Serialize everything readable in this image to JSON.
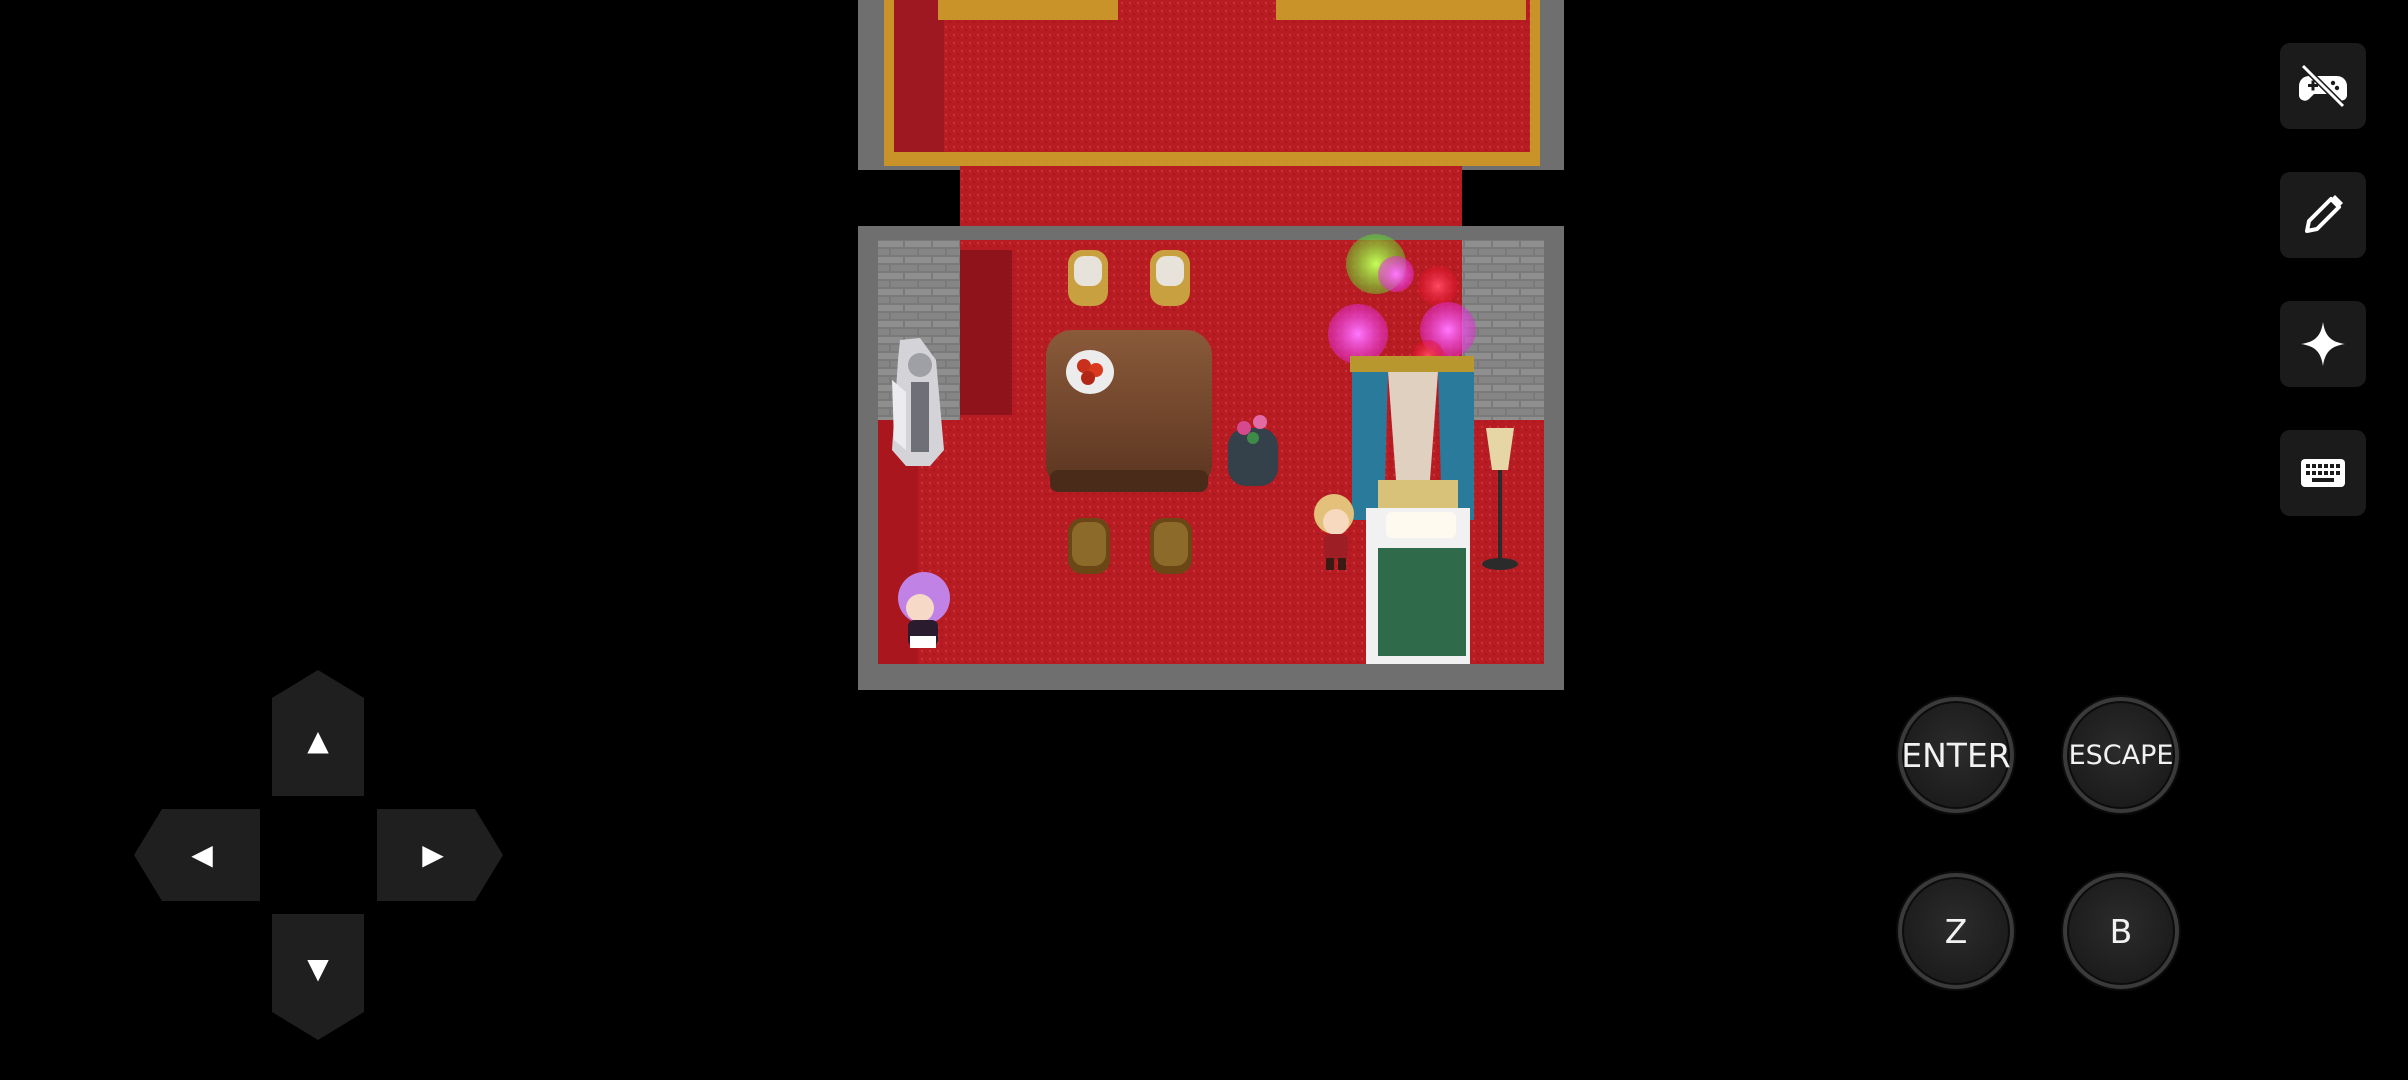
{
  "toolbar": {
    "buttons": [
      {
        "icon": "gamepad-off-icon"
      },
      {
        "icon": "pencil-icon"
      },
      {
        "icon": "sparkle-icon"
      },
      {
        "icon": "keyboard-icon"
      }
    ]
  },
  "actions": {
    "enter_label": "ENTER",
    "escape_label": "ESCAPE",
    "z_label": "Z",
    "b_label": "B"
  },
  "dpad": {
    "up": "▲",
    "down": "▼",
    "left": "◀",
    "right": "▶"
  },
  "scene": {
    "floor_color": "#b81c23",
    "wall_color": "#8e8e8e",
    "bed_cover_color": "#2f6a4a",
    "curtain_color": "#2a7a9c"
  }
}
